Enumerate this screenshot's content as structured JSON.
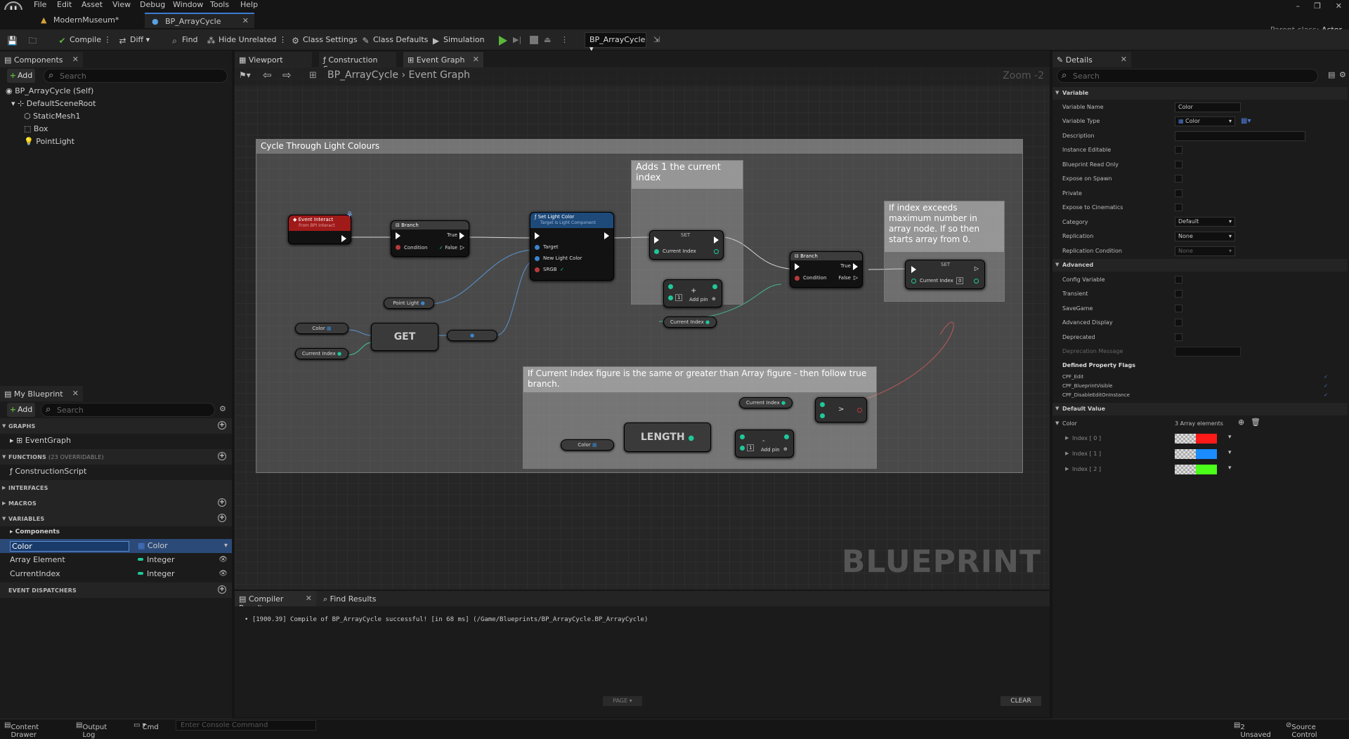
{
  "menu": [
    "File",
    "Edit",
    "Asset",
    "View",
    "Debug",
    "Window",
    "Tools",
    "Help"
  ],
  "doc_tabs": [
    {
      "label": "ModernMuseum*"
    },
    {
      "label": "BP_ArrayCycle"
    }
  ],
  "parent_class": {
    "label": "Parent class:",
    "value": "Actor"
  },
  "toolbar": {
    "compile": "Compile",
    "diff": "Diff",
    "find": "Find",
    "hide_unrelated": "Hide Unrelated",
    "class_settings": "Class Settings",
    "class_defaults": "Class Defaults",
    "simulation": "Simulation",
    "debug_object": "BP_ArrayCycle"
  },
  "components": {
    "tab": "Components",
    "add": "Add",
    "search_placeholder": "Search",
    "items": [
      "BP_ArrayCycle (Self)",
      "DefaultSceneRoot",
      "StaticMesh1",
      "Box",
      "PointLight"
    ]
  },
  "my_blueprint": {
    "tab": "My Blueprint",
    "add": "Add",
    "search_placeholder": "Search",
    "graphs": "GRAPHS",
    "event_graph": "EventGraph",
    "functions": "FUNCTIONS",
    "functions_count": "(23 OVERRIDABLE)",
    "construction_script": "ConstructionScript",
    "interfaces": "INTERFACES",
    "macros": "MACROS",
    "variables": "VARIABLES",
    "components_cat": "Components",
    "variables_list": [
      {
        "name": "Color",
        "type": "Color"
      },
      {
        "name": "Array Element",
        "type": "Integer"
      },
      {
        "name": "CurrentIndex",
        "type": "Integer"
      }
    ],
    "event_dispatchers": "EVENT DISPATCHERS"
  },
  "editor_tabs": [
    "Viewport",
    "Construction Sc...",
    "Event Graph"
  ],
  "breadcrumb": {
    "root": "BP_ArrayCycle",
    "current": "Event Graph"
  },
  "zoom": "Zoom -2",
  "watermark": "BLUEPRINT",
  "graph": {
    "main_comment": "Cycle Through Light Colours",
    "add_comment": "Adds 1 the current index",
    "exceed_comment": "If index exceeds maximum number in array node. If so then starts array from 0.",
    "branch_comment": "If Current Index figure is the same or greater than Array figure - then follow true branch.",
    "event_interact": "Event Interact",
    "event_interact_sub": "From BPI Interact",
    "branch": "Branch",
    "true": "True",
    "false": "False",
    "condition": "Condition",
    "set_light_color": "Set Light Color",
    "set_light_color_sub": "Target is Light Component",
    "target": "Target",
    "new_light_color": "New Light Color",
    "srgb": "SRGB",
    "point_light": "Point Light",
    "color": "Color",
    "current_index": "Current Index",
    "get": "GET",
    "set": "SET",
    "add_pin": "Add pin",
    "length": "LENGTH",
    "plus": "+",
    "minus": "-",
    "gt": ">",
    "one": "1",
    "zero": "0"
  },
  "details": {
    "tab": "Details",
    "search_placeholder": "Search",
    "variable_section": "Variable",
    "rows": {
      "variable_name": "Variable Name",
      "variable_type": "Variable Type",
      "description": "Description",
      "instance_editable": "Instance Editable",
      "blueprint_read_only": "Blueprint Read Only",
      "expose_on_spawn": "Expose on Spawn",
      "private": "Private",
      "expose_to_cinematics": "Expose to Cinematics",
      "category": "Category",
      "replication": "Replication",
      "replication_condition": "Replication Condition"
    },
    "values": {
      "variable_name": "Color",
      "variable_type": "Color",
      "category": "Default",
      "replication": "None",
      "replication_condition": "None"
    },
    "advanced_section": "Advanced",
    "advanced_rows": [
      "Config Variable",
      "Transient",
      "SaveGame",
      "Advanced Display",
      "Deprecated",
      "Deprecation Message"
    ],
    "defined_flags": "Defined Property Flags",
    "flags": [
      "CPF_Edit",
      "CPF_BlueprintVisible",
      "CPF_DisableEditOnInstance"
    ],
    "default_value_section": "Default Value",
    "default_color_label": "Color",
    "array_count": "3 Array elements",
    "indices": [
      {
        "label": "Index [ 0 ]",
        "color": "#ff1a1a"
      },
      {
        "label": "Index [ 1 ]",
        "color": "#1a8cff"
      },
      {
        "label": "Index [ 2 ]",
        "color": "#4cff1a"
      }
    ]
  },
  "bottom_tabs": [
    "Compiler Results",
    "Find Results"
  ],
  "compiler_message": "[1900.39] Compile of BP_ArrayCycle successful! [in 68 ms] (/Game/Blueprints/BP_ArrayCycle.BP_ArrayCycle)",
  "page_label": "PAGE",
  "clear_label": "CLEAR",
  "statusbar": {
    "content_drawer": "Content Drawer",
    "output_log": "Output Log",
    "cmd": "Cmd",
    "console_placeholder": "Enter Console Command",
    "unsaved": "2 Unsaved",
    "source_control": "Source Control"
  }
}
